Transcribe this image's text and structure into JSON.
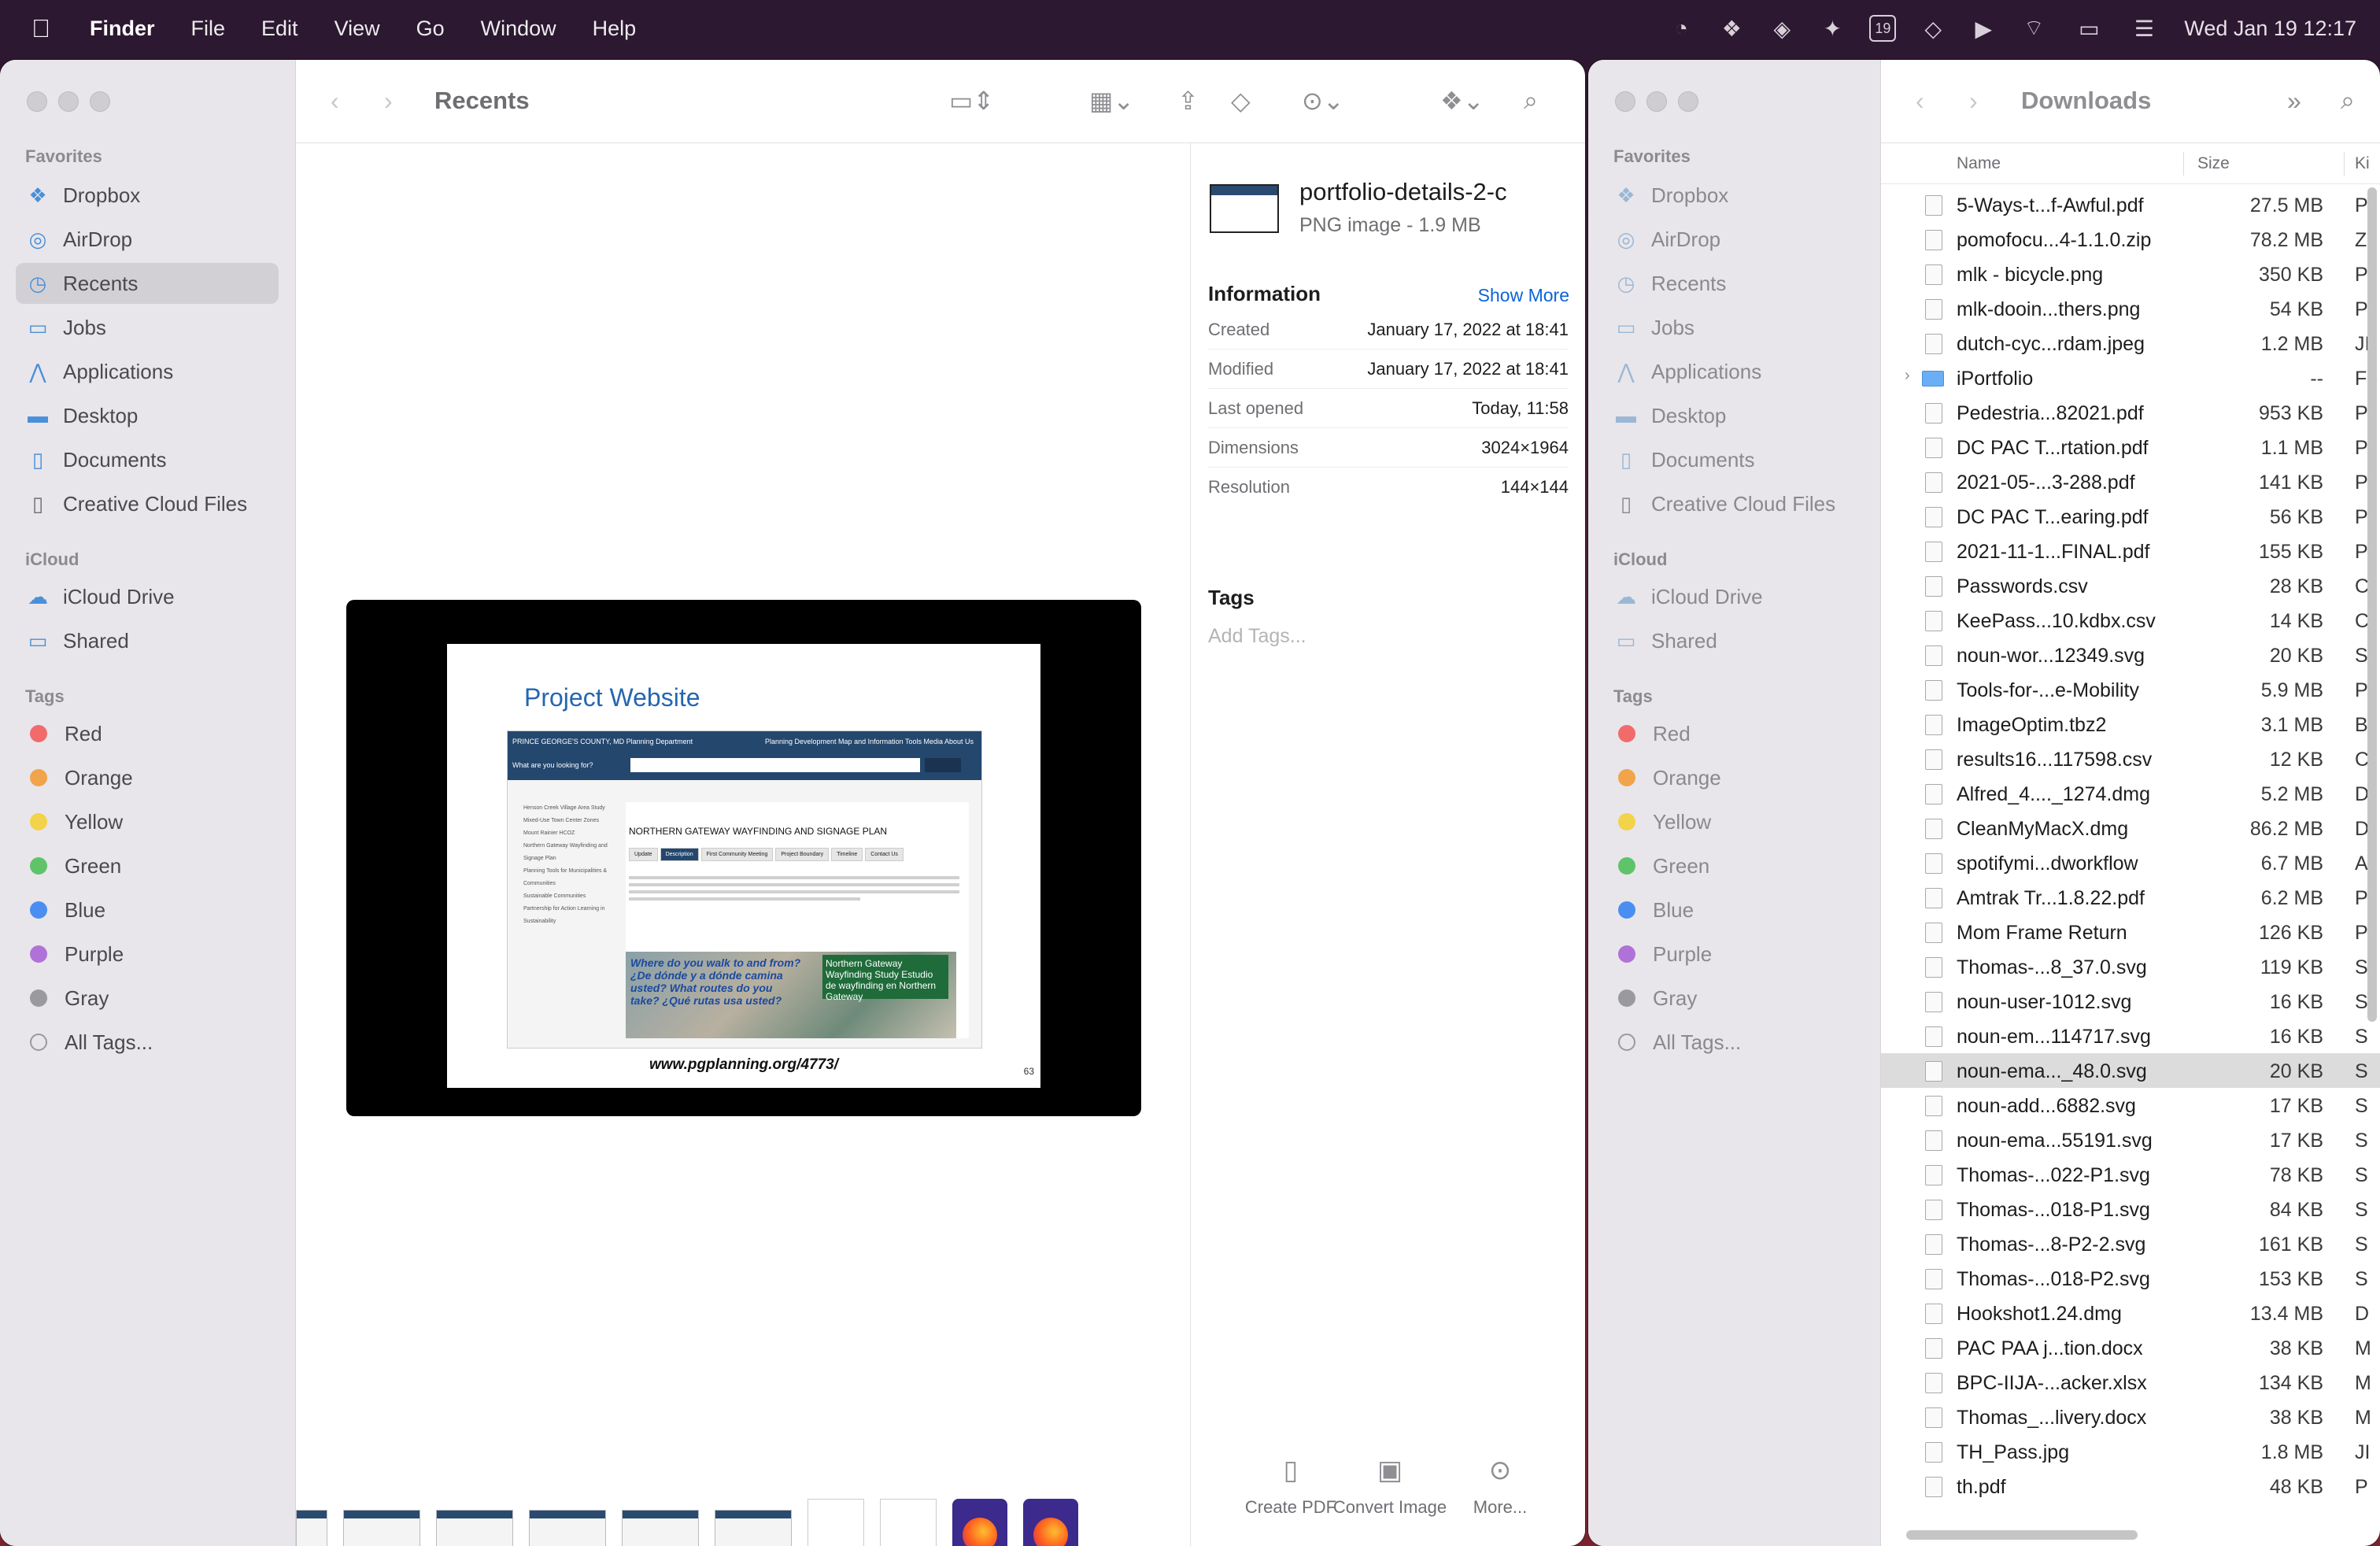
{
  "menubar": {
    "app": "Finder",
    "items": [
      "File",
      "Edit",
      "View",
      "Go",
      "Window",
      "Help"
    ],
    "clock": "Wed Jan 19  12:17",
    "calendar_day": "19"
  },
  "left_window": {
    "title": "Recents",
    "sidebar": {
      "favorites_label": "Favorites",
      "favorites": [
        {
          "label": "Dropbox",
          "icon": "dropbox-icon"
        },
        {
          "label": "AirDrop",
          "icon": "airdrop-icon"
        },
        {
          "label": "Recents",
          "icon": "clock-icon"
        },
        {
          "label": "Jobs",
          "icon": "folder-icon"
        },
        {
          "label": "Applications",
          "icon": "applications-icon"
        },
        {
          "label": "Desktop",
          "icon": "desktop-icon"
        },
        {
          "label": "Documents",
          "icon": "document-icon"
        },
        {
          "label": "Creative Cloud Files",
          "icon": "file-icon"
        }
      ],
      "icloud_label": "iCloud",
      "icloud": [
        {
          "label": "iCloud Drive",
          "icon": "cloud-icon"
        },
        {
          "label": "Shared",
          "icon": "shared-folder-icon"
        }
      ],
      "tags_label": "Tags",
      "tags": [
        {
          "label": "Red",
          "color": "#f26b6b"
        },
        {
          "label": "Orange",
          "color": "#f2a44a"
        },
        {
          "label": "Yellow",
          "color": "#f2d34a"
        },
        {
          "label": "Green",
          "color": "#5fc36a"
        },
        {
          "label": "Blue",
          "color": "#4a8ef2"
        },
        {
          "label": "Purple",
          "color": "#b072d8"
        },
        {
          "label": "Gray",
          "color": "#9a9a9e"
        },
        {
          "label": "All Tags...",
          "color": ""
        }
      ]
    },
    "preview": {
      "slide_title": "Project Website",
      "site_brand": "PRINCE GEORGE'S COUNTY, MD Planning Department",
      "site_nav": "Planning   Development   Map and Information Tools   Media   About Us",
      "site_search": "What are you looking for?",
      "site_heading": "NORTHERN GATEWAY WAYFINDING AND SIGNAGE PLAN",
      "site_tabs": [
        "Update",
        "Description",
        "First Community Meeting",
        "Project Boundary",
        "Timeline",
        "Contact Us"
      ],
      "site_side": [
        "Henson Creek Village Area Study",
        "Mixed-Use Town Center Zones",
        "Mount Rainier HCOZ",
        "Northern Gateway Wayfinding and Signage Plan",
        "Planning Tools for Municipalities & Communities",
        "Sustainable Communities",
        "Partnership for Action Learning in Sustainability"
      ],
      "photo_question": "Where do you walk to and from? ¿De dónde y a dónde camina usted? What routes do you take? ¿Qué rutas usa usted?",
      "photo_sign": "Northern Gateway Wayfinding Study Estudio de wayfinding en Northern Gateway",
      "url": "www.pgplanning.org/4773/",
      "page_number": "63"
    },
    "inspector": {
      "name": "portfolio-details-2-c",
      "kind": "PNG image - 1.9 MB",
      "info_heading": "Information",
      "show_more": "Show More",
      "rows": [
        {
          "k": "Created",
          "v": "January 17, 2022 at 18:41"
        },
        {
          "k": "Modified",
          "v": "January 17, 2022 at 18:41"
        },
        {
          "k": "Last opened",
          "v": "Today, 11:58"
        },
        {
          "k": "Dimensions",
          "v": "3024×1964"
        },
        {
          "k": "Resolution",
          "v": "144×144"
        }
      ],
      "tags_heading": "Tags",
      "tags_placeholder": "Add Tags...",
      "actions": [
        {
          "label": "Create PDF",
          "icon": "create-pdf-icon"
        },
        {
          "label": "Convert Image",
          "icon": "convert-image-icon"
        },
        {
          "label": "More...",
          "icon": "more-icon"
        }
      ]
    }
  },
  "right_window": {
    "title": "Downloads",
    "columns": [
      "Name",
      "Size",
      "Ki"
    ],
    "rows": [
      {
        "name": "5-Ways-t...f-Awful.pdf",
        "size": "27.5 MB",
        "kind": "P"
      },
      {
        "name": "pomofocu...4-1.1.0.zip",
        "size": "78.2 MB",
        "kind": "Z"
      },
      {
        "name": "mlk - bicycle.png",
        "size": "350 KB",
        "kind": "P"
      },
      {
        "name": "mlk-dooin...thers.png",
        "size": "54 KB",
        "kind": "P"
      },
      {
        "name": "dutch-cyc...rdam.jpeg",
        "size": "1.2 MB",
        "kind": "JI"
      },
      {
        "name": "iPortfolio",
        "size": "--",
        "kind": "Fo",
        "folder": true
      },
      {
        "name": "Pedestria...82021.pdf",
        "size": "953 KB",
        "kind": "P"
      },
      {
        "name": "DC PAC T...rtation.pdf",
        "size": "1.1 MB",
        "kind": "P"
      },
      {
        "name": "2021-05-...3-288.pdf",
        "size": "141 KB",
        "kind": "P"
      },
      {
        "name": "DC PAC T...earing.pdf",
        "size": "56 KB",
        "kind": "P"
      },
      {
        "name": "2021-11-1...FINAL.pdf",
        "size": "155 KB",
        "kind": "P"
      },
      {
        "name": "Passwords.csv",
        "size": "28 KB",
        "kind": "C"
      },
      {
        "name": "KeePass...10.kdbx.csv",
        "size": "14 KB",
        "kind": "C"
      },
      {
        "name": "noun-wor...12349.svg",
        "size": "20 KB",
        "kind": "S"
      },
      {
        "name": "Tools-for-...e-Mobility",
        "size": "5.9 MB",
        "kind": "P"
      },
      {
        "name": "ImageOptim.tbz2",
        "size": "3.1 MB",
        "kind": "B"
      },
      {
        "name": "results16...117598.csv",
        "size": "12 KB",
        "kind": "C"
      },
      {
        "name": "Alfred_4...._1274.dmg",
        "size": "5.2 MB",
        "kind": "D"
      },
      {
        "name": "CleanMyMacX.dmg",
        "size": "86.2 MB",
        "kind": "D"
      },
      {
        "name": "spotifymi...dworkflow",
        "size": "6.7 MB",
        "kind": "A"
      },
      {
        "name": "Amtrak Tr...1.8.22.pdf",
        "size": "6.2 MB",
        "kind": "P"
      },
      {
        "name": "Mom Frame Return",
        "size": "126 KB",
        "kind": "P"
      },
      {
        "name": "Thomas-...8_37.0.svg",
        "size": "119 KB",
        "kind": "S"
      },
      {
        "name": "noun-user-1012.svg",
        "size": "16 KB",
        "kind": "S"
      },
      {
        "name": "noun-em...114717.svg",
        "size": "16 KB",
        "kind": "S"
      },
      {
        "name": "noun-ema..._48.0.svg",
        "size": "20 KB",
        "kind": "S",
        "selected": true
      },
      {
        "name": "noun-add...6882.svg",
        "size": "17 KB",
        "kind": "S"
      },
      {
        "name": "noun-ema...55191.svg",
        "size": "17 KB",
        "kind": "S"
      },
      {
        "name": "Thomas-...022-P1.svg",
        "size": "78 KB",
        "kind": "S"
      },
      {
        "name": "Thomas-...018-P1.svg",
        "size": "84 KB",
        "kind": "S"
      },
      {
        "name": "Thomas-...8-P2-2.svg",
        "size": "161 KB",
        "kind": "S"
      },
      {
        "name": "Thomas-...018-P2.svg",
        "size": "153 KB",
        "kind": "S"
      },
      {
        "name": "Hookshot1.24.dmg",
        "size": "13.4 MB",
        "kind": "D"
      },
      {
        "name": "PAC PAA j...tion.docx",
        "size": "38 KB",
        "kind": "M"
      },
      {
        "name": "BPC-IIJA-...acker.xlsx",
        "size": "134 KB",
        "kind": "M"
      },
      {
        "name": "Thomas_...livery.docx",
        "size": "38 KB",
        "kind": "M"
      },
      {
        "name": "TH_Pass.jpg",
        "size": "1.8 MB",
        "kind": "JI"
      },
      {
        "name": "th.pdf",
        "size": "48 KB",
        "kind": "P"
      }
    ]
  }
}
